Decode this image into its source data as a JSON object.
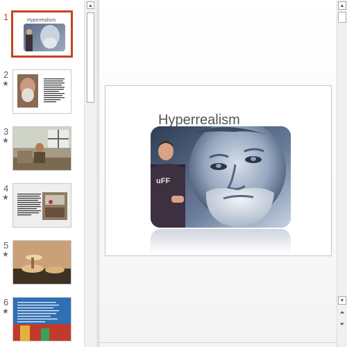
{
  "thumbnails": [
    {
      "number": "1",
      "star": "",
      "title": "Hyperrealism"
    },
    {
      "number": "2",
      "star": "★"
    },
    {
      "number": "3",
      "star": "★"
    },
    {
      "number": "4",
      "star": "★"
    },
    {
      "number": "5",
      "star": "★"
    },
    {
      "number": "6",
      "star": "★"
    }
  ],
  "slide": {
    "title": "Hyperrealism"
  },
  "scroll": {
    "up_icon": "▲",
    "down_icon": "▼",
    "prev_icon": "⏶",
    "next_icon": "⏷"
  },
  "colors": {
    "accent": "#c3431e"
  }
}
